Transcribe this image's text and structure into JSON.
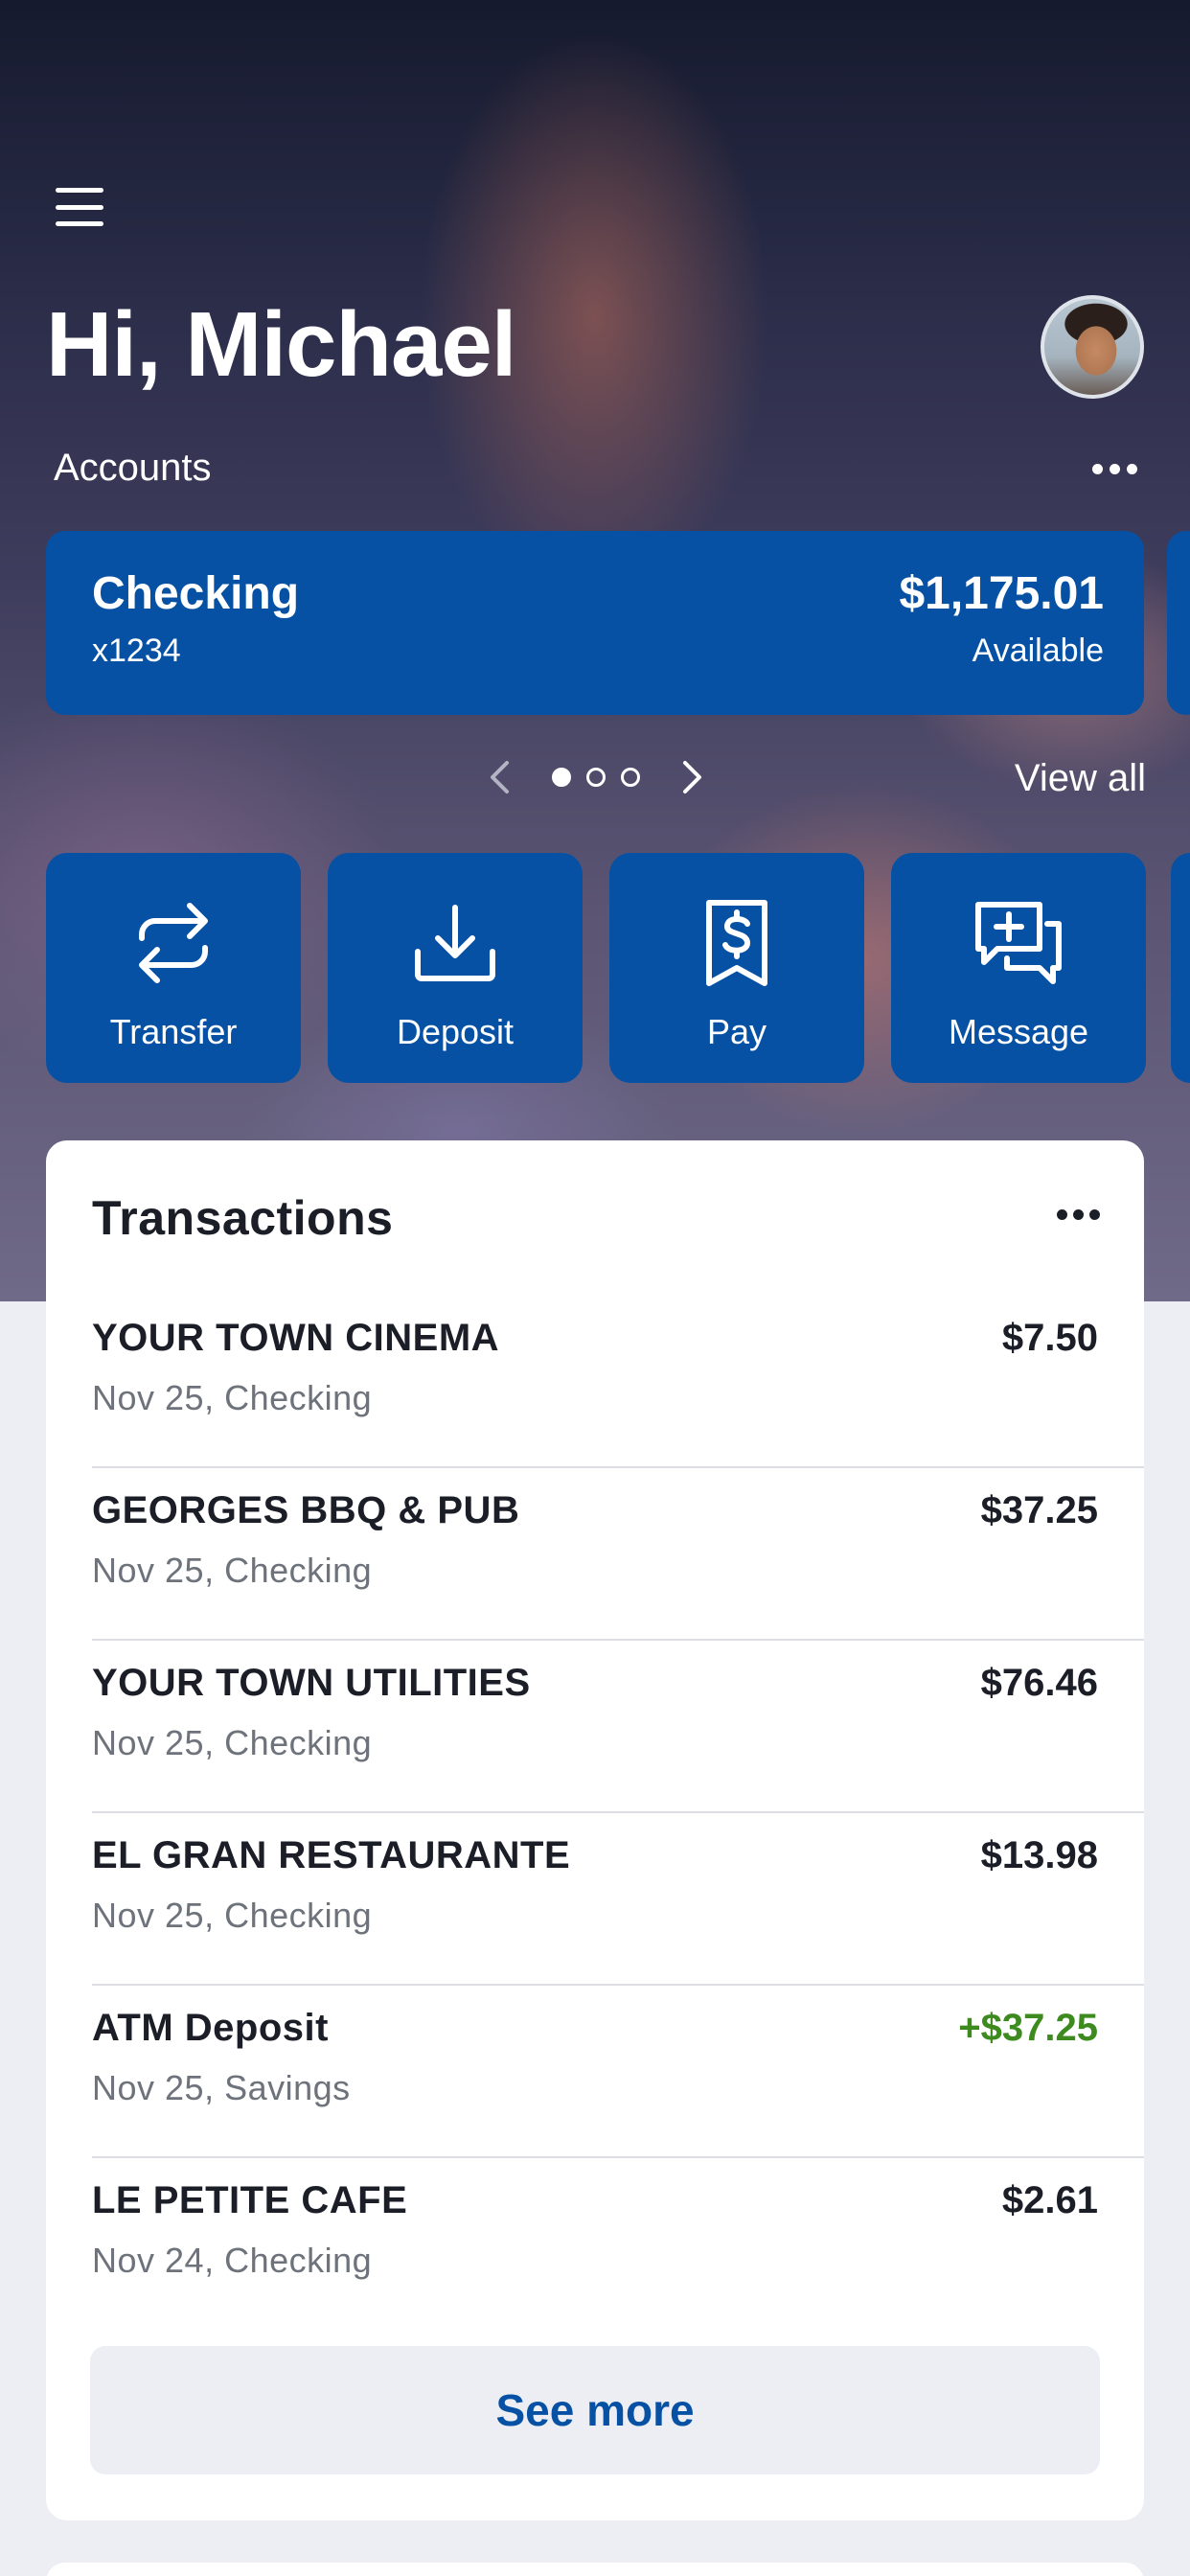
{
  "header": {
    "menu_icon": "hamburger-menu-icon",
    "greeting": "Hi, Michael",
    "avatar": "user-profile-photo"
  },
  "accounts": {
    "label": "Accounts",
    "more_icon": "more-horizontal-icon",
    "current_page": 1,
    "total_pages": 3,
    "view_all": "View all",
    "cards": [
      {
        "name": "Checking",
        "number": "x1234",
        "balance": "$1,175.01",
        "balance_label": "Available"
      }
    ]
  },
  "actions": [
    {
      "label": "Transfer",
      "icon": "transfer-arrows-icon"
    },
    {
      "label": "Deposit",
      "icon": "download-deposit-icon"
    },
    {
      "label": "Pay",
      "icon": "dollar-receipt-icon"
    },
    {
      "label": "Message",
      "icon": "chat-add-icon"
    }
  ],
  "transactions": {
    "title": "Transactions",
    "more_icon": "more-horizontal-icon",
    "items": [
      {
        "name": "YOUR TOWN CINEMA",
        "sub": "Nov 25, Checking",
        "amount": "$7.50",
        "credit": false
      },
      {
        "name": "GEORGES BBQ & PUB",
        "sub": "Nov 25, Checking",
        "amount": "$37.25",
        "credit": false
      },
      {
        "name": "YOUR TOWN UTILITIES",
        "sub": "Nov 25, Checking",
        "amount": "$76.46",
        "credit": false
      },
      {
        "name": "EL GRAN RESTAURANTE",
        "sub": "Nov 25, Checking",
        "amount": "$13.98",
        "credit": false
      },
      {
        "name": "ATM Deposit",
        "sub": "Nov 25, Savings",
        "amount": "+$37.25",
        "credit": true
      },
      {
        "name": "LE PETITE CAFE",
        "sub": "Nov 24, Checking",
        "amount": "$2.61",
        "credit": false
      }
    ],
    "see_more": "See more"
  },
  "colors": {
    "brand_blue": "#0651a4",
    "credit_green": "#3d8a1f",
    "muted_text": "#6d727b",
    "page_background": "#eceef4"
  }
}
